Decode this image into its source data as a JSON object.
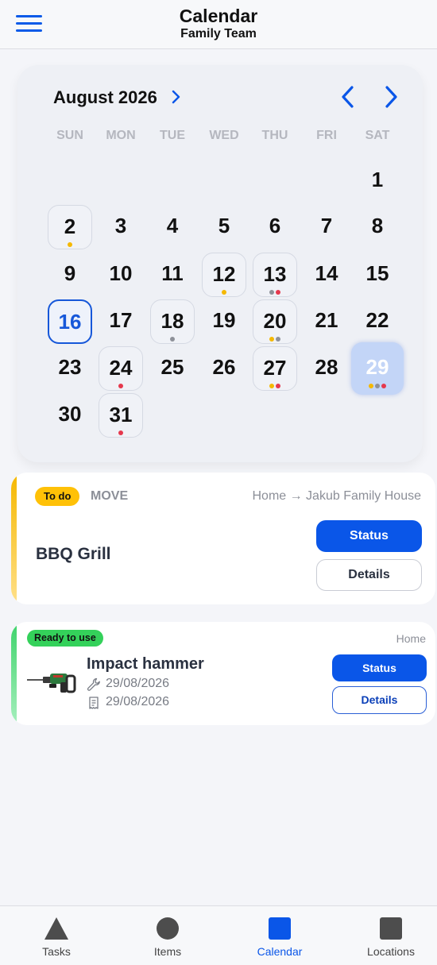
{
  "header": {
    "title": "Calendar",
    "subtitle": "Family Team",
    "menu_icon": "hamburger-menu-icon"
  },
  "calendar": {
    "month_label": "August 2026",
    "weekdays": [
      "SUN",
      "MON",
      "TUE",
      "WED",
      "THU",
      "FRI",
      "SAT"
    ],
    "first_weekday_index": 6,
    "days_in_month": 31,
    "today": 16,
    "selected": 29,
    "event_colors": {
      "yellow": "#f5b800",
      "red": "#e5384d",
      "gray": "#8e9199"
    },
    "events": {
      "2": [
        "yellow"
      ],
      "12": [
        "yellow"
      ],
      "13": [
        "gray",
        "red"
      ],
      "18": [
        "gray"
      ],
      "20": [
        "yellow",
        "gray"
      ],
      "24": [
        "red"
      ],
      "27": [
        "yellow",
        "red"
      ],
      "29": [
        "yellow",
        "gray",
        "red"
      ],
      "31": [
        "red"
      ]
    }
  },
  "task_card": {
    "status": "To do",
    "type": "MOVE",
    "route": "Home → Jakub Family House",
    "name": "BBQ Grill",
    "status_button": "Status",
    "details_button": "Details",
    "accent_color": "#f5b800"
  },
  "item_card": {
    "status": "Ready to use",
    "location": "Home",
    "name": "Impact hammer",
    "service_date": "29/08/2026",
    "invoice_date": "29/08/2026",
    "status_button": "Status",
    "details_button": "Details",
    "accent_color": "#3ed36b"
  },
  "tabbar": {
    "active": "Calendar",
    "tabs": [
      {
        "label": "Tasks",
        "icon": "triangle-icon"
      },
      {
        "label": "Items",
        "icon": "circle-icon"
      },
      {
        "label": "Calendar",
        "icon": "square-icon"
      },
      {
        "label": "Locations",
        "icon": "square-icon"
      }
    ]
  }
}
